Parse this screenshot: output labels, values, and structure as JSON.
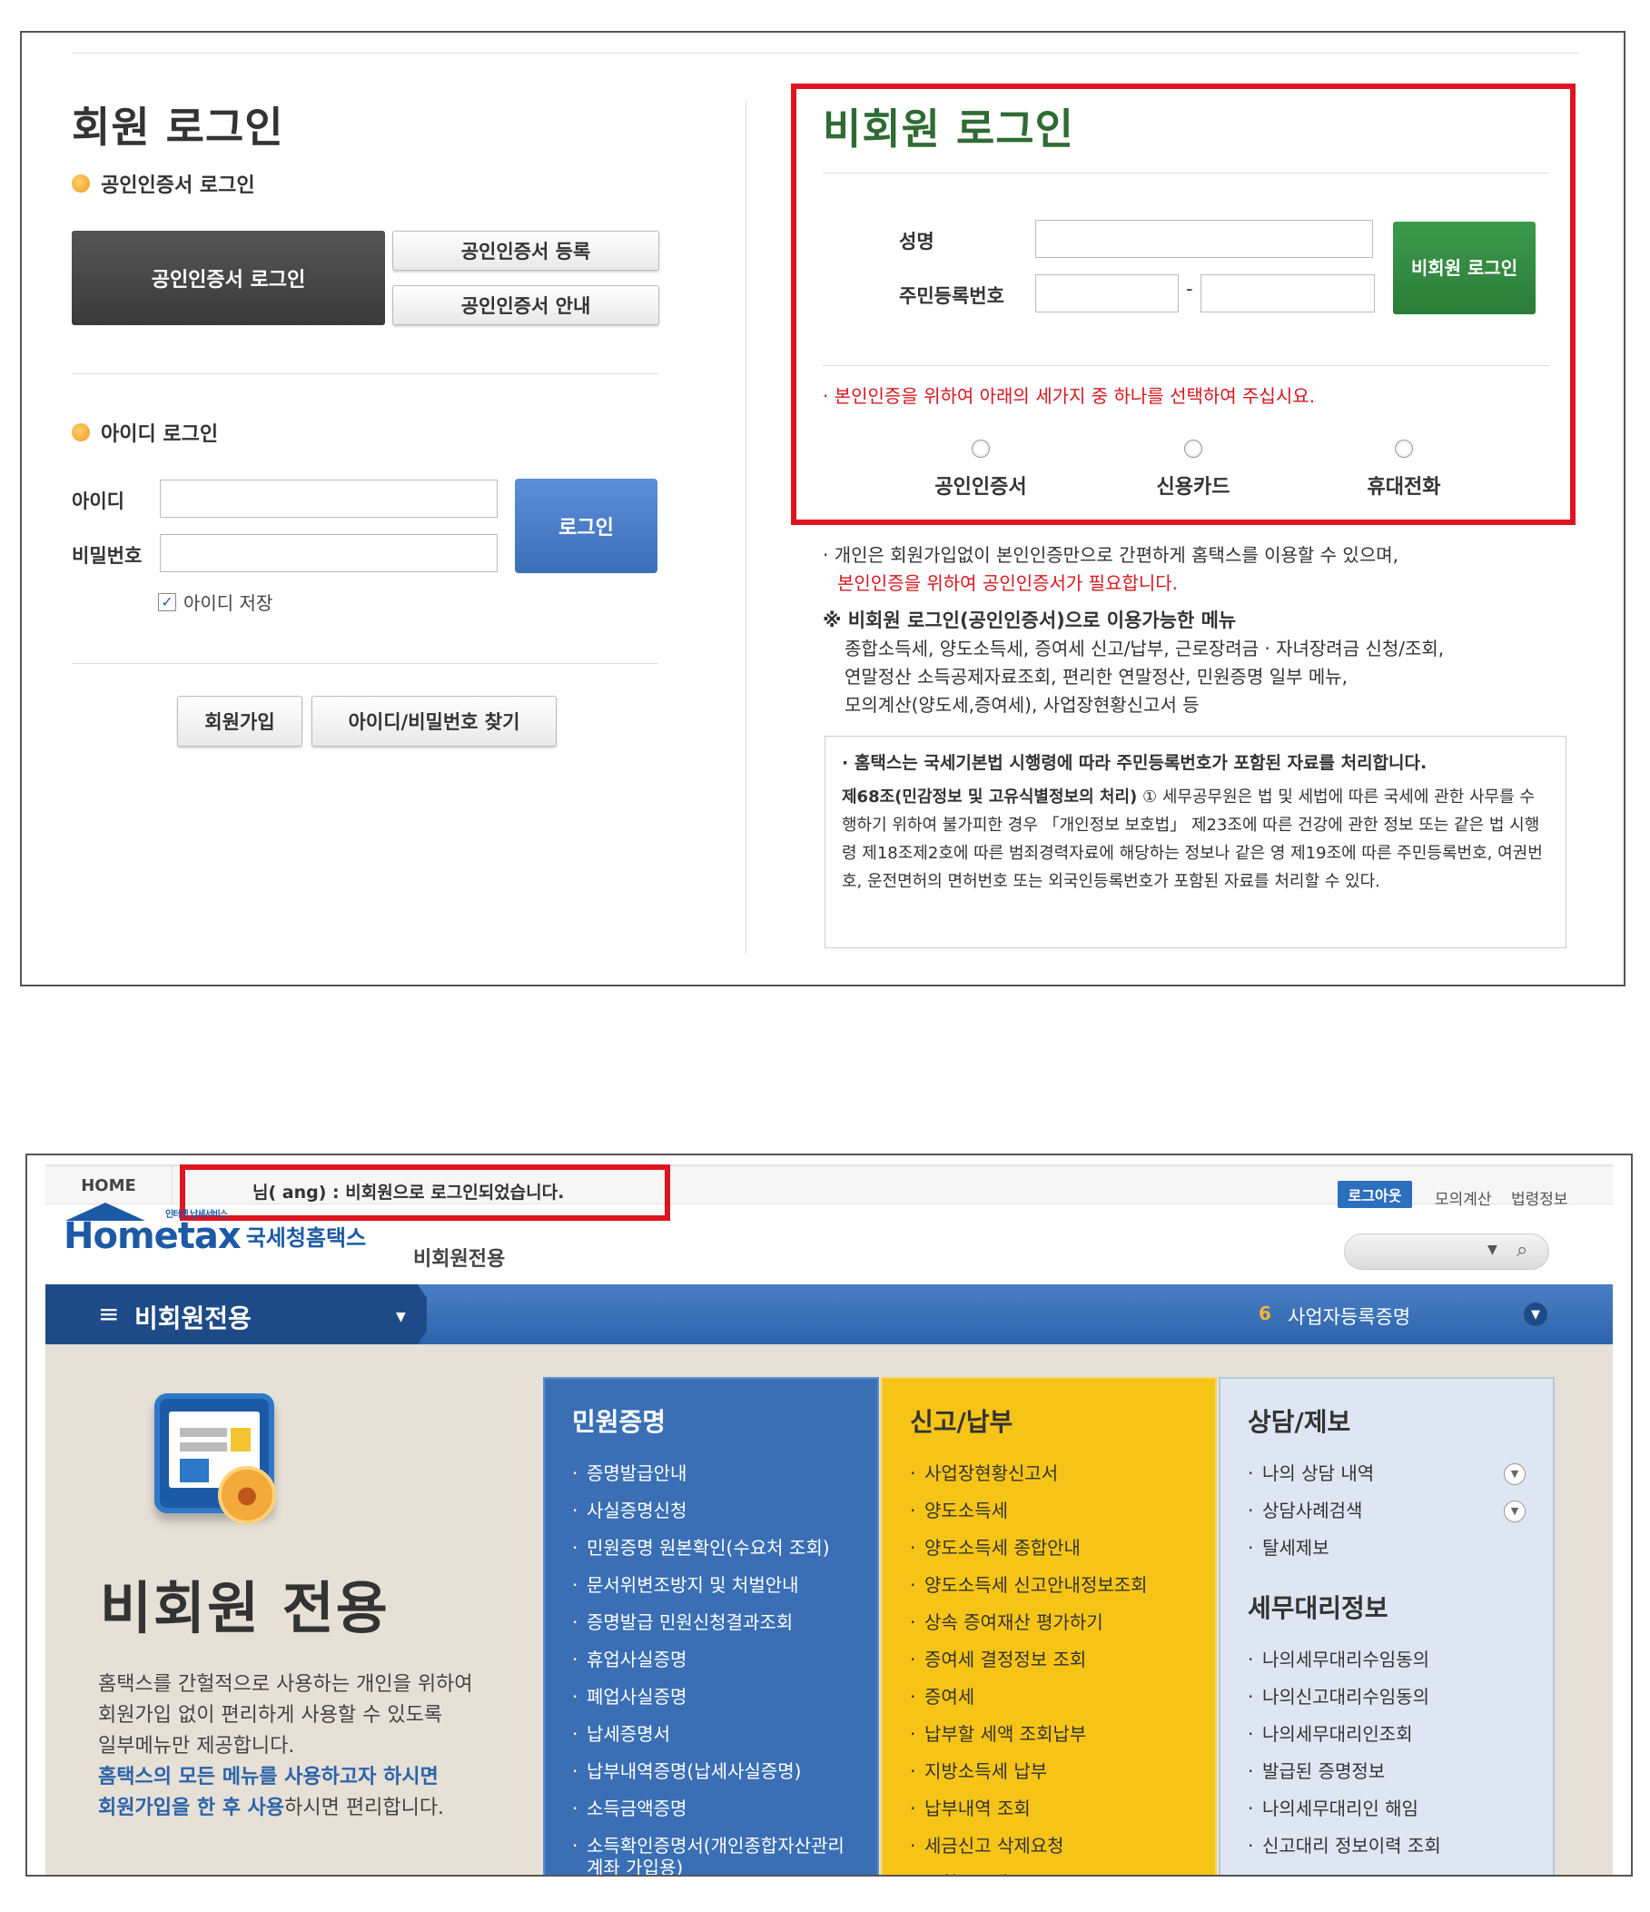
{
  "login": {
    "member_title": "회원 로그인",
    "cert_section": "공인인증서 로그인",
    "cert_login_btn": "공인인증서 로그인",
    "cert_register_btn": "공인인증서 등록",
    "cert_guide_btn": "공인인증서 안내",
    "id_section": "아이디 로그인",
    "id_label": "아이디",
    "pw_label": "비밀번호",
    "login_btn": "로그인",
    "save_id": "아이디 저장",
    "signup_btn": "회원가입",
    "find_btn": "아이디/비밀번호 찾기"
  },
  "nonmember": {
    "title": "비회원 로그인",
    "name_label": "성명",
    "rrn_label": "주민등록번호",
    "rrn_sep": "-",
    "login_btn": "비회원 로그인",
    "select_note": "본인인증을 위하여 아래의 세가지 중 하나를 선택하여 주십시요.",
    "options": [
      "공인인증서",
      "신용카드",
      "휴대전화"
    ],
    "info_line1": "개인은 회원가입없이 본인인증만으로 간편하게 홈택스를 이용할 수 있으며,",
    "info_line2": "본인인증을 위하여 공인인증서가 필요합니다.",
    "menu_head": "※ 비회원 로그인(공인인증서)으로 이용가능한 메뉴",
    "menu_lines": [
      "종합소득세, 양도소득세, 증여세 신고/납부, 근로장려금 · 자녀장려금 신청/조회,",
      "연말정산 소득공제자료조회, 편리한 연말정산, 민원증명 일부 메뉴,",
      "모의계산(양도세,증여세), 사업장현황신고서 등"
    ],
    "legal_head": "홈택스는 국세기본법 시행령에 따라 주민등록번호가 포함된 자료를 처리합니다.",
    "legal_article": "제68조(민감정보 및 고유식별정보의 처리)",
    "legal_body": "① 세무공무원은 법 및 세법에 따른 국세에 관한 사무를 수행하기 위하여 불가피한 경우 「개인정보 보호법」 제23조에 따른 건강에 관한 정보 또는 같은 법 시행령 제18조제2호에 따른 범죄경력자료에 해당하는 정보나 같은 영 제19조에 따른 주민등록번호, 여권번호, 운전면허의 면허번호 또는 외국인등록번호가 포함된 자료를 처리할 수 있다."
  },
  "hometax": {
    "home": "HOME",
    "notice": "님(  ang) : 비회원으로 로그인되었습니다.",
    "logout": "로그아웃",
    "link1": "모의계산",
    "link2": "법령정보",
    "logo_tag": "인터넷 납세서비스",
    "logo_text": "Hometax",
    "logo_name": "국세청홈택스",
    "site_sub": "비회원전용",
    "nav_title": "비회원전용",
    "nav_num": "6",
    "nav_item": "사업자등록증명",
    "big_title": "비회원 전용",
    "desc1": "홈택스를 간헐적으로 사용하는 개인을 위하여",
    "desc2": "회원가입 없이 편리하게 사용할 수 있도록",
    "desc3": "일부메뉴만 제공합니다.",
    "desc4": "홈택스의 모든 메뉴를 사용하고자 하시면",
    "desc5a": "회원가입을 한 후 사용",
    "desc5b": "하시면 편리합니다.",
    "col1": {
      "title": "민원증명",
      "items": [
        "증명발급안내",
        "사실증명신청",
        "민원증명 원본확인(수요처 조회)",
        "문서위변조방지 및 처벌안내",
        "증명발급 민원신청결과조회",
        "휴업사실증명",
        "폐업사실증명",
        "납세증명서",
        "납부내역증명(납세사실증명)",
        "소득금액증명",
        "소득확인증명서(개인종합자산관리계좌 가입용)"
      ]
    },
    "col2": {
      "title": "신고/납부",
      "items": [
        "사업장현황신고서",
        "양도소득세",
        "양도소득세 종합안내",
        "양도소득세 신고안내정보조회",
        "상속 증여재산 평가하기",
        "증여세 결정정보 조회",
        "증여세",
        "납부할 세액 조회납부",
        "지방소득세 납부",
        "납부내역 조회",
        "세금신고 삭제요청",
        "종합소득세"
      ]
    },
    "col3": {
      "title": "상담/제보",
      "items": [
        "나의 상담 내역",
        "상담사례검색",
        "탈세제보"
      ],
      "title2": "세무대리정보",
      "items2": [
        "나의세무대리수임동의",
        "나의신고대리수임동의",
        "나의세무대리인조회",
        "발급된 증명정보",
        "나의세무대리인 해임",
        "신고대리 정보이력 조회"
      ]
    }
  }
}
